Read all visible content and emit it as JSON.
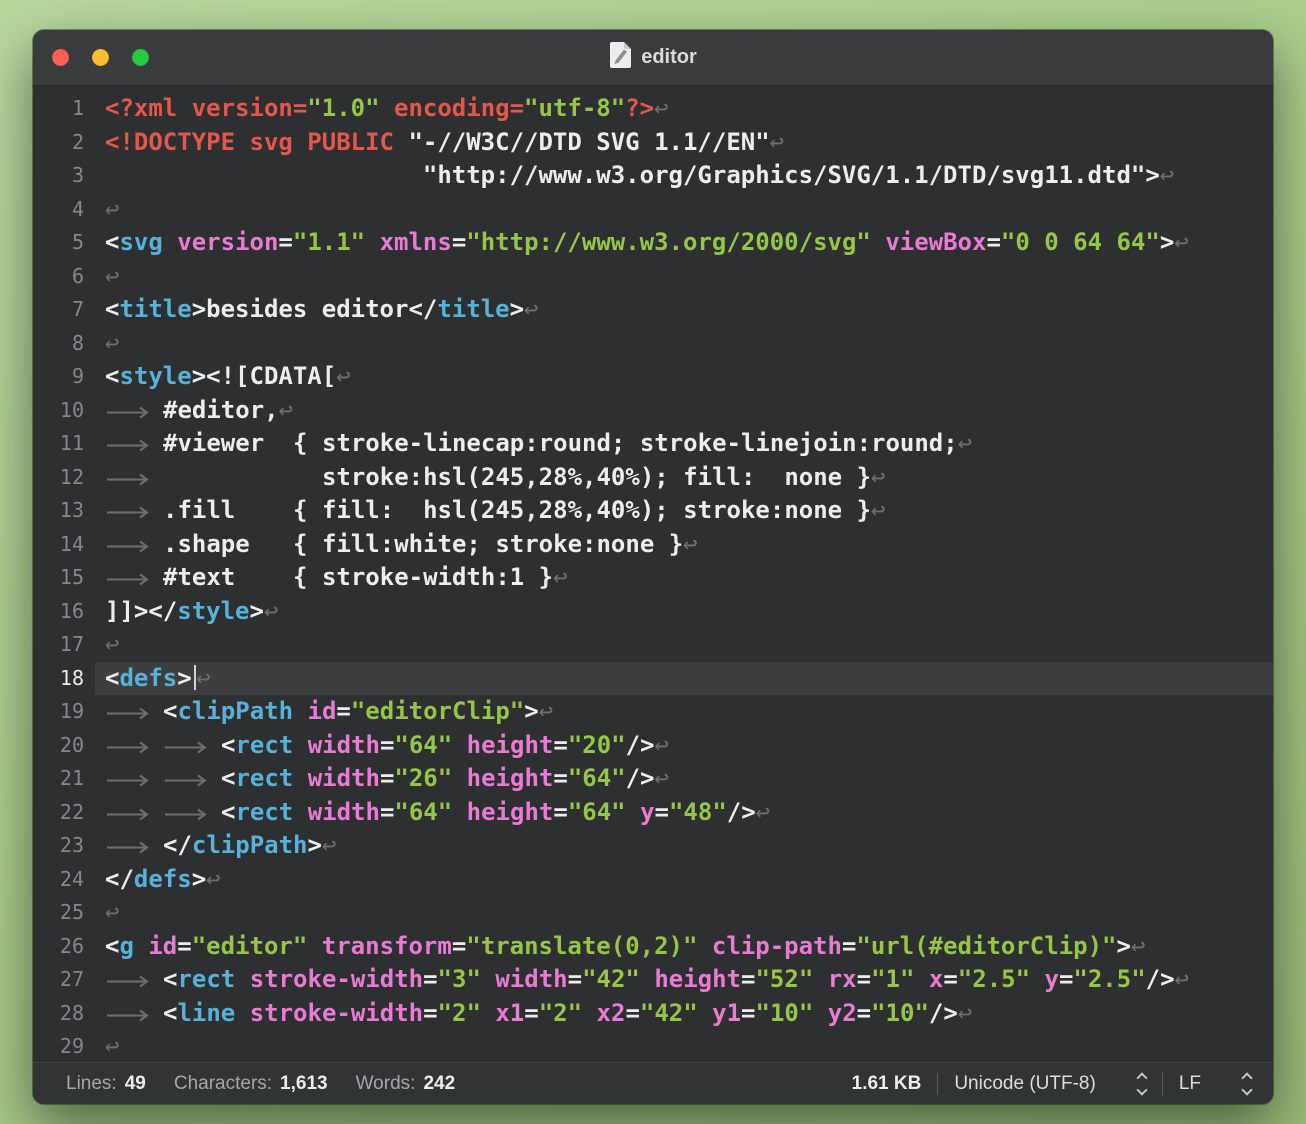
{
  "window": {
    "title": "editor",
    "traffic_lights": {
      "close": "#FF5F57",
      "minimize": "#FEBC2E",
      "zoom": "#28C840"
    }
  },
  "editor": {
    "current_line": 18,
    "invisibles": {
      "tab": "⟶",
      "newline": "↩"
    },
    "colors": {
      "background": "#2E2F30",
      "current_line_bg": "#3D3E40",
      "keyword": "#E2584C",
      "tag": "#57B2D9",
      "attribute": "#E87BD4",
      "value": "#94C748",
      "plain": "#EDEDEE",
      "invisible": "#6C6F70",
      "line_number": "#85888A",
      "line_number_current": "#EAEBEC",
      "caret": "#D2D3D4"
    },
    "lines": [
      {
        "n": 1,
        "tokens": [
          [
            "k",
            "<?xml version="
          ],
          [
            "v",
            "\"1.0\""
          ],
          [
            "k",
            " encoding="
          ],
          [
            "v",
            "\"utf-8\""
          ],
          [
            "k",
            "?>"
          ],
          [
            "ret"
          ]
        ]
      },
      {
        "n": 2,
        "tokens": [
          [
            "k",
            "<!DOCTYPE svg PUBLIC "
          ],
          [
            "p",
            "\"-//W3C//DTD SVG 1.1//EN\""
          ],
          [
            "ret"
          ]
        ]
      },
      {
        "n": 3,
        "tokens": [
          [
            "p",
            "                      \"http://www.w3.org/Graphics/SVG/1.1/DTD/svg11.dtd\">"
          ],
          [
            "ret"
          ]
        ]
      },
      {
        "n": 4,
        "tokens": [
          [
            "ret"
          ]
        ]
      },
      {
        "n": 5,
        "tokens": [
          [
            "p",
            "<"
          ],
          [
            "t",
            "svg"
          ],
          [
            "p",
            " "
          ],
          [
            "a",
            "version"
          ],
          [
            "p",
            "="
          ],
          [
            "v",
            "\"1.1\""
          ],
          [
            "p",
            " "
          ],
          [
            "a",
            "xmlns"
          ],
          [
            "p",
            "="
          ],
          [
            "v",
            "\"http://www.w3.org/2000/svg\""
          ],
          [
            "p",
            " "
          ],
          [
            "a",
            "viewBox"
          ],
          [
            "p",
            "="
          ],
          [
            "v",
            "\"0 0 64 64\""
          ],
          [
            "p",
            ">"
          ],
          [
            "ret"
          ]
        ]
      },
      {
        "n": 6,
        "tokens": [
          [
            "ret"
          ]
        ]
      },
      {
        "n": 7,
        "tokens": [
          [
            "p",
            "<"
          ],
          [
            "t",
            "title"
          ],
          [
            "p",
            ">besides editor</"
          ],
          [
            "t",
            "title"
          ],
          [
            "p",
            ">"
          ],
          [
            "ret"
          ]
        ]
      },
      {
        "n": 8,
        "tokens": [
          [
            "ret"
          ]
        ]
      },
      {
        "n": 9,
        "tokens": [
          [
            "p",
            "<"
          ],
          [
            "t",
            "style"
          ],
          [
            "p",
            "><![CDATA["
          ],
          [
            "ret"
          ]
        ]
      },
      {
        "n": 10,
        "tokens": [
          [
            "tab"
          ],
          [
            "p",
            "#editor,"
          ],
          [
            "ret"
          ]
        ]
      },
      {
        "n": 11,
        "tokens": [
          [
            "tab"
          ],
          [
            "p",
            "#viewer  { stroke-linecap:round; stroke-linejoin:round;"
          ],
          [
            "ret"
          ]
        ]
      },
      {
        "n": 12,
        "tokens": [
          [
            "tab"
          ],
          [
            "p",
            "           stroke:hsl(245,28%,40%); fill:  none }"
          ],
          [
            "ret"
          ]
        ]
      },
      {
        "n": 13,
        "tokens": [
          [
            "tab"
          ],
          [
            "p",
            ".fill    { fill:  hsl(245,28%,40%); stroke:none }"
          ],
          [
            "ret"
          ]
        ]
      },
      {
        "n": 14,
        "tokens": [
          [
            "tab"
          ],
          [
            "p",
            ".shape   { fill:white; stroke:none }"
          ],
          [
            "ret"
          ]
        ]
      },
      {
        "n": 15,
        "tokens": [
          [
            "tab"
          ],
          [
            "p",
            "#text    { stroke-width:1 }"
          ],
          [
            "ret"
          ]
        ]
      },
      {
        "n": 16,
        "tokens": [
          [
            "p",
            "]]></"
          ],
          [
            "t",
            "style"
          ],
          [
            "p",
            ">"
          ],
          [
            "ret"
          ]
        ]
      },
      {
        "n": 17,
        "tokens": [
          [
            "ret"
          ]
        ]
      },
      {
        "n": 18,
        "tokens": [
          [
            "p",
            "<"
          ],
          [
            "t",
            "defs"
          ],
          [
            "p",
            ">"
          ],
          [
            "cursor"
          ],
          [
            "ret"
          ]
        ]
      },
      {
        "n": 19,
        "tokens": [
          [
            "tab"
          ],
          [
            "p",
            "<"
          ],
          [
            "t",
            "clipPath"
          ],
          [
            "p",
            " "
          ],
          [
            "a",
            "id"
          ],
          [
            "p",
            "="
          ],
          [
            "v",
            "\"editorClip\""
          ],
          [
            "p",
            ">"
          ],
          [
            "ret"
          ]
        ]
      },
      {
        "n": 20,
        "tokens": [
          [
            "tab"
          ],
          [
            "tab"
          ],
          [
            "p",
            "<"
          ],
          [
            "t",
            "rect"
          ],
          [
            "p",
            " "
          ],
          [
            "a",
            "width"
          ],
          [
            "p",
            "="
          ],
          [
            "v",
            "\"64\""
          ],
          [
            "p",
            " "
          ],
          [
            "a",
            "height"
          ],
          [
            "p",
            "="
          ],
          [
            "v",
            "\"20\""
          ],
          [
            "p",
            "/>"
          ],
          [
            "ret"
          ]
        ]
      },
      {
        "n": 21,
        "tokens": [
          [
            "tab"
          ],
          [
            "tab"
          ],
          [
            "p",
            "<"
          ],
          [
            "t",
            "rect"
          ],
          [
            "p",
            " "
          ],
          [
            "a",
            "width"
          ],
          [
            "p",
            "="
          ],
          [
            "v",
            "\"26\""
          ],
          [
            "p",
            " "
          ],
          [
            "a",
            "height"
          ],
          [
            "p",
            "="
          ],
          [
            "v",
            "\"64\""
          ],
          [
            "p",
            "/>"
          ],
          [
            "ret"
          ]
        ]
      },
      {
        "n": 22,
        "tokens": [
          [
            "tab"
          ],
          [
            "tab"
          ],
          [
            "p",
            "<"
          ],
          [
            "t",
            "rect"
          ],
          [
            "p",
            " "
          ],
          [
            "a",
            "width"
          ],
          [
            "p",
            "="
          ],
          [
            "v",
            "\"64\""
          ],
          [
            "p",
            " "
          ],
          [
            "a",
            "height"
          ],
          [
            "p",
            "="
          ],
          [
            "v",
            "\"64\""
          ],
          [
            "p",
            " "
          ],
          [
            "a",
            "y"
          ],
          [
            "p",
            "="
          ],
          [
            "v",
            "\"48\""
          ],
          [
            "p",
            "/>"
          ],
          [
            "ret"
          ]
        ]
      },
      {
        "n": 23,
        "tokens": [
          [
            "tab"
          ],
          [
            "p",
            "</"
          ],
          [
            "t",
            "clipPath"
          ],
          [
            "p",
            ">"
          ],
          [
            "ret"
          ]
        ]
      },
      {
        "n": 24,
        "tokens": [
          [
            "p",
            "</"
          ],
          [
            "t",
            "defs"
          ],
          [
            "p",
            ">"
          ],
          [
            "ret"
          ]
        ]
      },
      {
        "n": 25,
        "tokens": [
          [
            "ret"
          ]
        ]
      },
      {
        "n": 26,
        "tokens": [
          [
            "p",
            "<"
          ],
          [
            "t",
            "g"
          ],
          [
            "p",
            " "
          ],
          [
            "a",
            "id"
          ],
          [
            "p",
            "="
          ],
          [
            "v",
            "\"editor\""
          ],
          [
            "p",
            " "
          ],
          [
            "a",
            "transform"
          ],
          [
            "p",
            "="
          ],
          [
            "v",
            "\"translate(0,2)\""
          ],
          [
            "p",
            " "
          ],
          [
            "a",
            "clip-path"
          ],
          [
            "p",
            "="
          ],
          [
            "v",
            "\"url(#editorClip)\""
          ],
          [
            "p",
            ">"
          ],
          [
            "ret"
          ]
        ]
      },
      {
        "n": 27,
        "tokens": [
          [
            "tab"
          ],
          [
            "p",
            "<"
          ],
          [
            "t",
            "rect"
          ],
          [
            "p",
            " "
          ],
          [
            "a",
            "stroke-width"
          ],
          [
            "p",
            "="
          ],
          [
            "v",
            "\"3\""
          ],
          [
            "p",
            " "
          ],
          [
            "a",
            "width"
          ],
          [
            "p",
            "="
          ],
          [
            "v",
            "\"42\""
          ],
          [
            "p",
            " "
          ],
          [
            "a",
            "height"
          ],
          [
            "p",
            "="
          ],
          [
            "v",
            "\"52\""
          ],
          [
            "p",
            " "
          ],
          [
            "a",
            "rx"
          ],
          [
            "p",
            "="
          ],
          [
            "v",
            "\"1\""
          ],
          [
            "p",
            " "
          ],
          [
            "a",
            "x"
          ],
          [
            "p",
            "="
          ],
          [
            "v",
            "\"2.5\""
          ],
          [
            "p",
            " "
          ],
          [
            "a",
            "y"
          ],
          [
            "p",
            "="
          ],
          [
            "v",
            "\"2.5\""
          ],
          [
            "p",
            "/>"
          ],
          [
            "ret"
          ]
        ]
      },
      {
        "n": 28,
        "tokens": [
          [
            "tab"
          ],
          [
            "p",
            "<"
          ],
          [
            "t",
            "line"
          ],
          [
            "p",
            " "
          ],
          [
            "a",
            "stroke-width"
          ],
          [
            "p",
            "="
          ],
          [
            "v",
            "\"2\""
          ],
          [
            "p",
            " "
          ],
          [
            "a",
            "x1"
          ],
          [
            "p",
            "="
          ],
          [
            "v",
            "\"2\""
          ],
          [
            "p",
            " "
          ],
          [
            "a",
            "x2"
          ],
          [
            "p",
            "="
          ],
          [
            "v",
            "\"42\""
          ],
          [
            "p",
            " "
          ],
          [
            "a",
            "y1"
          ],
          [
            "p",
            "="
          ],
          [
            "v",
            "\"10\""
          ],
          [
            "p",
            " "
          ],
          [
            "a",
            "y2"
          ],
          [
            "p",
            "="
          ],
          [
            "v",
            "\"10\""
          ],
          [
            "p",
            "/>"
          ],
          [
            "ret"
          ]
        ]
      },
      {
        "n": 29,
        "tokens": [
          [
            "ret"
          ]
        ]
      }
    ]
  },
  "status_bar": {
    "lines_label": "Lines:",
    "lines_value": "49",
    "characters_label": "Characters:",
    "characters_value": "1,613",
    "words_label": "Words:",
    "words_value": "242",
    "file_size": "1.61 KB",
    "encoding": "Unicode (UTF-8)",
    "line_ending": "LF"
  }
}
